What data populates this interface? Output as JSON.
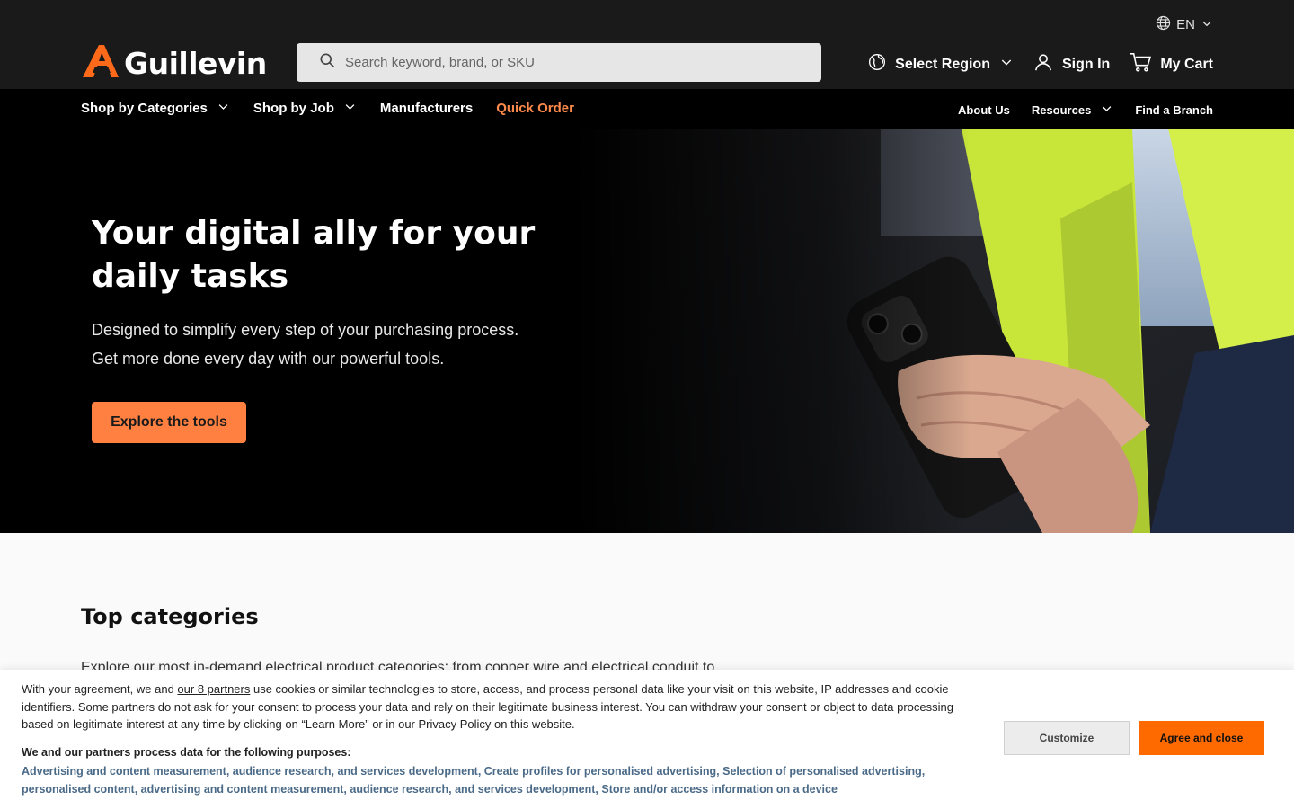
{
  "header": {
    "language": "EN",
    "logo_text": "Guillevin",
    "search_placeholder": "Search keyword, brand, or SKU",
    "region_label": "Select Region",
    "signin_label": "Sign In",
    "cart_label": "My Cart"
  },
  "nav": {
    "left": [
      {
        "label": "Shop by Categories",
        "dropdown": true
      },
      {
        "label": "Shop by Job",
        "dropdown": true
      },
      {
        "label": "Manufacturers",
        "dropdown": false
      },
      {
        "label": "Quick Order",
        "dropdown": false
      }
    ],
    "right": [
      {
        "label": "About Us",
        "dropdown": false
      },
      {
        "label": "Resources",
        "dropdown": true
      },
      {
        "label": "Find a Branch",
        "dropdown": false
      }
    ]
  },
  "hero": {
    "title": "Your digital ally for your daily tasks",
    "subtitle": "Designed to simplify every step of your purchasing process. Get more done every day with our powerful tools.",
    "cta": "Explore the tools"
  },
  "categories": {
    "title": "Top categories",
    "description": "Explore our most in-demand electrical product categories: from copper wire and electrical conduit to"
  },
  "cookie": {
    "text_before": "With your agreement, we and ",
    "partners_link": "our 8 partners",
    "text_after": " use cookies or similar technologies to store, access, and process personal data like your visit on this website, IP addresses and cookie identifiers. Some partners do not ask for your consent to process your data and rely on their legitimate business interest. You can withdraw your consent or object to data processing based on legitimate interest at any time by clicking on “Learn More” or in our Privacy Policy on this website.",
    "purposes_title": "We and our partners process data for the following purposes:",
    "purposes": "Advertising and content measurement, audience research, and services development, Create profiles for personalised advertising, Selection of personalised advertising, personalised content, advertising and content measurement, audience research, and services development, Store and/or access information on a device",
    "customize_label": "Customize",
    "agree_label": "Agree and close"
  },
  "colors": {
    "accent": "#ff8040",
    "quick_order": "#ff8a4c",
    "agree_button": "#ff6a00",
    "header_bg": "#1a1a1a",
    "nav_bg": "#000000"
  },
  "icons": [
    "globe-icon",
    "chevron-down-icon",
    "search-icon",
    "region-globe-icon",
    "user-icon",
    "cart-icon",
    "guillevin-logo-icon"
  ]
}
